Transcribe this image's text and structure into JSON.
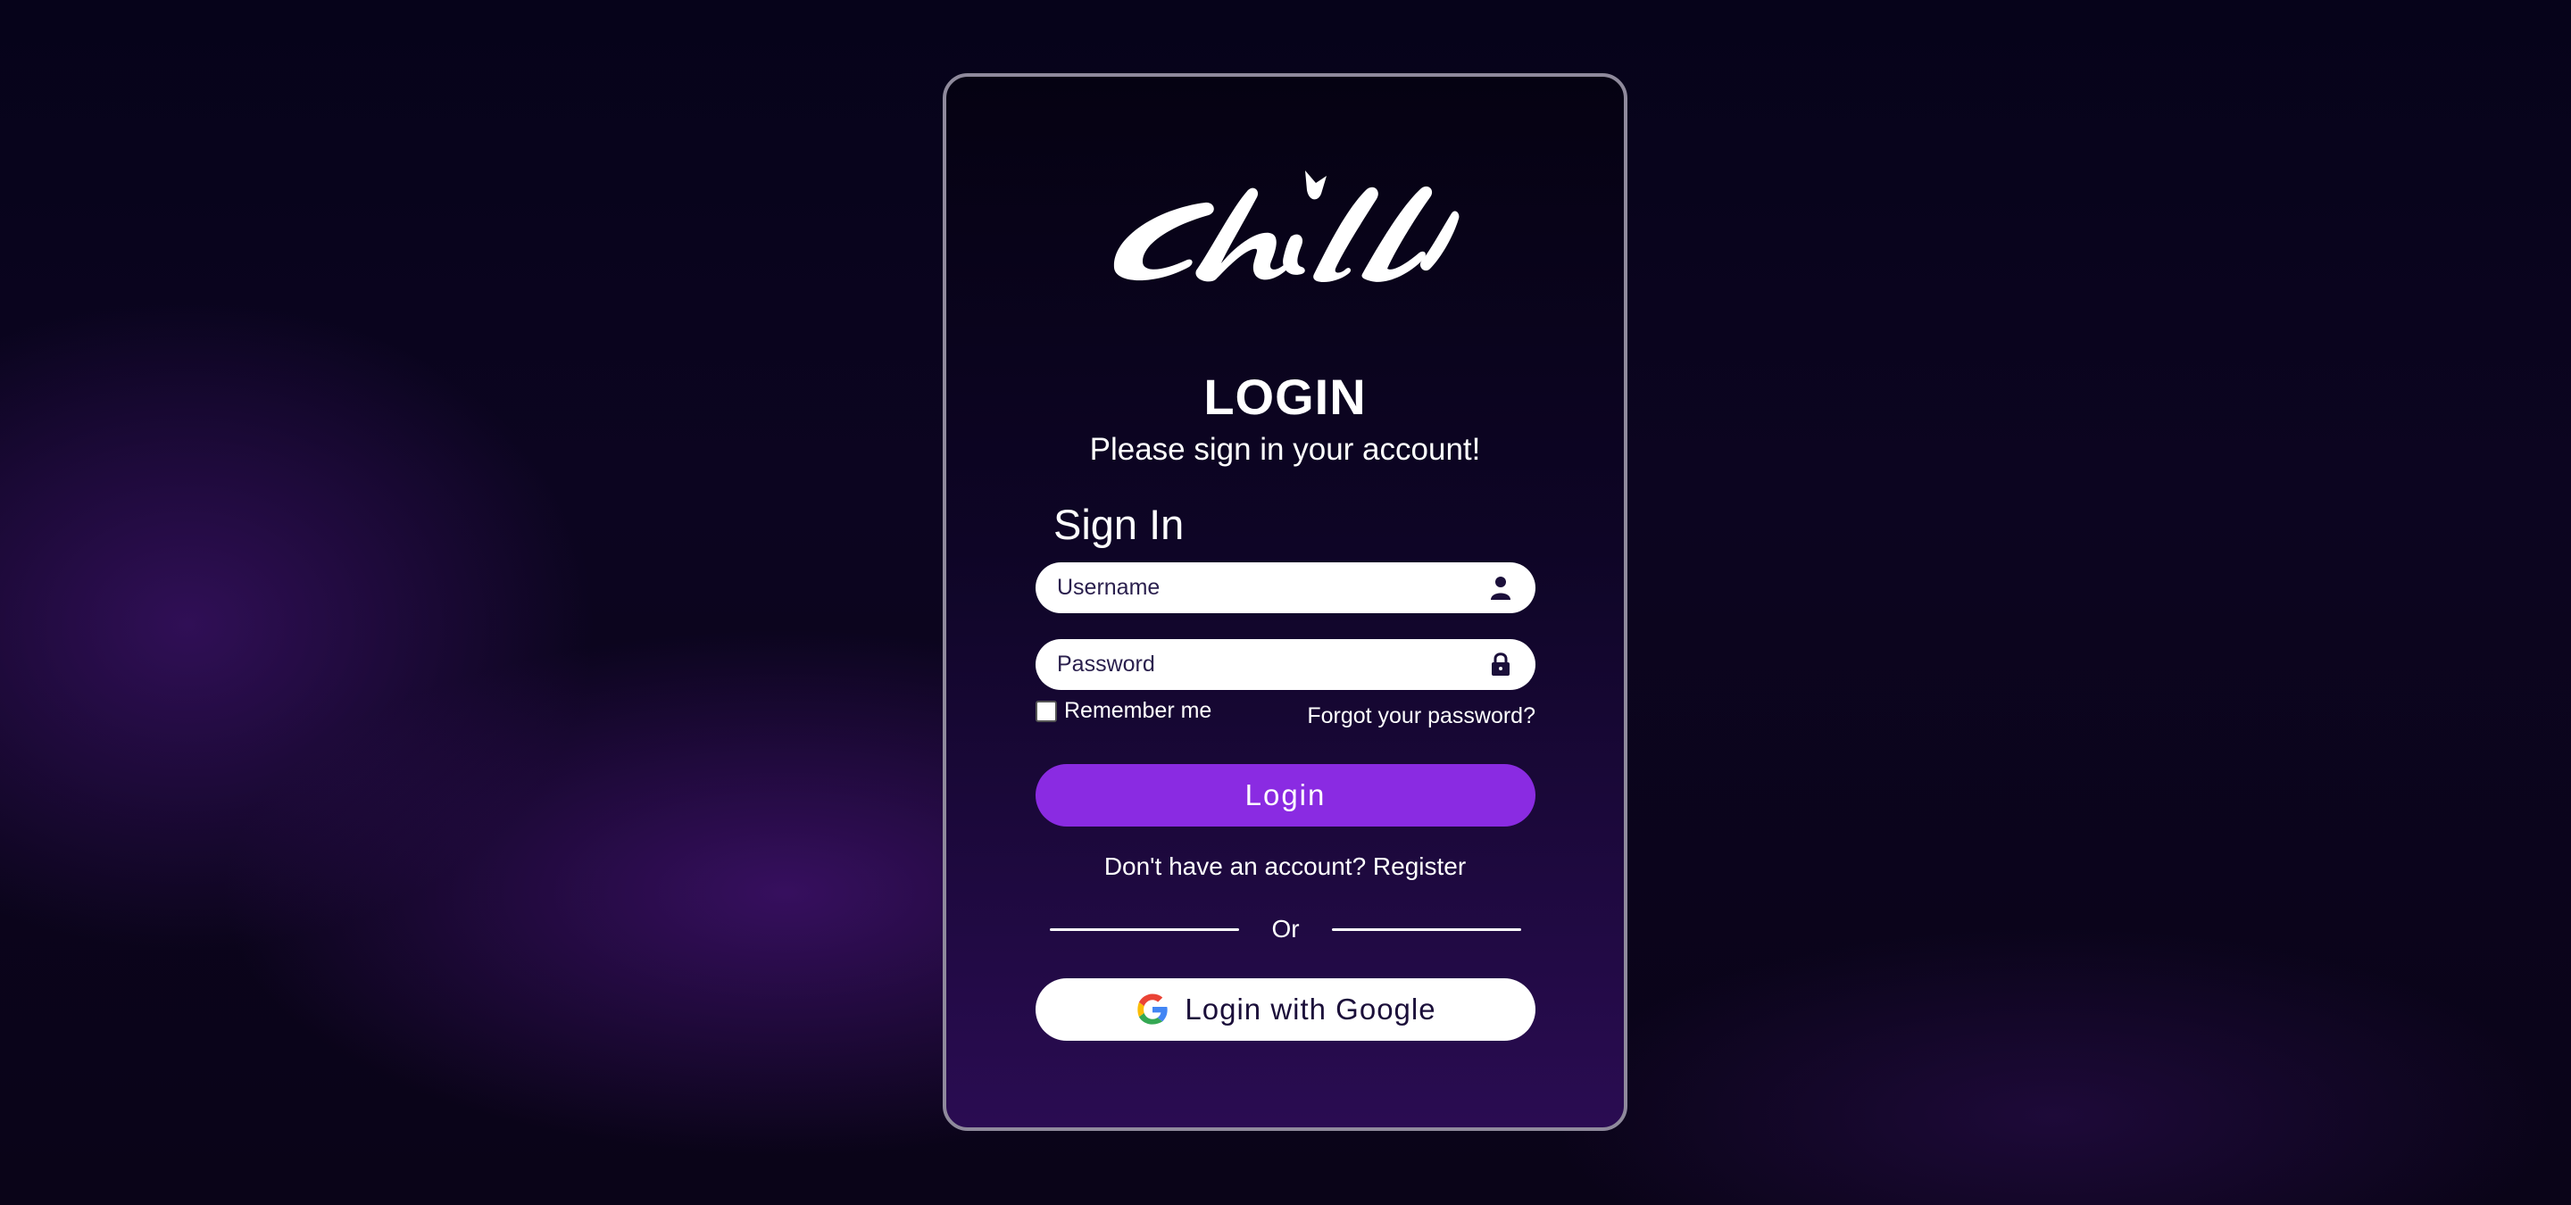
{
  "brand": {
    "logo_text": "chill",
    "accent_color": "#8a2be2"
  },
  "login": {
    "title": "LOGIN",
    "subtitle": "Please sign in your account!",
    "section_heading": "Sign In",
    "username": {
      "placeholder": "Username",
      "value": "",
      "icon": "user-icon"
    },
    "password": {
      "placeholder": "Password",
      "value": "",
      "icon": "lock-icon"
    },
    "remember_label": "Remember me",
    "remember_checked": false,
    "forgot_label": "Forgot your password?",
    "submit_label": "Login",
    "register_text": "Don't have an account? Register",
    "divider_text": "Or",
    "google_label": "Login with Google",
    "google_icon": "google-icon"
  }
}
